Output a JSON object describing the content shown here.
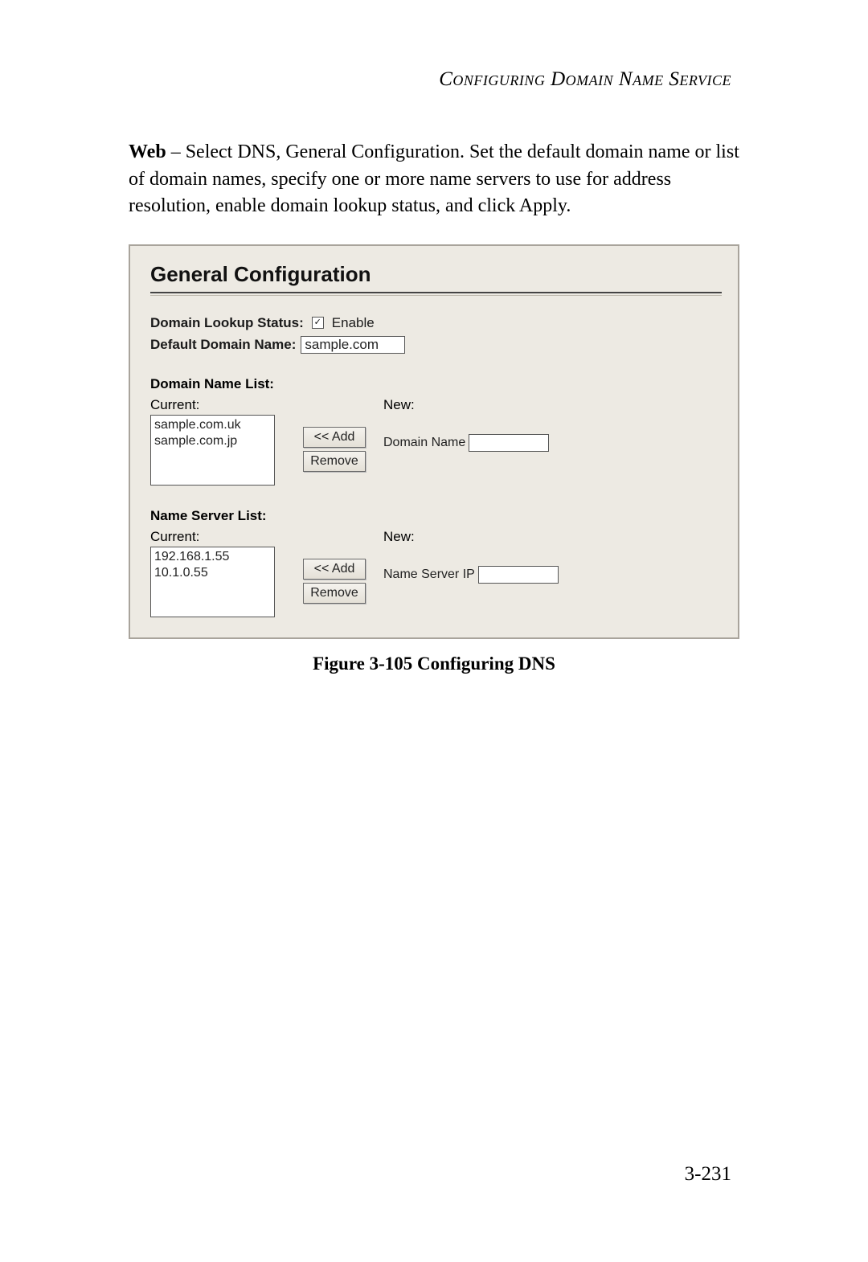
{
  "header": {
    "running_head": "Configuring Domain Name Service"
  },
  "body": {
    "lead": "Web",
    "text": " – Select DNS, General Configuration. Set the default domain name or list of domain names, specify one or more name servers to use for address resolution, enable domain lookup status, and click Apply."
  },
  "panel": {
    "title": "General Configuration",
    "lookup": {
      "label": "Domain Lookup Status:",
      "checkbox_checked": true,
      "checkbox_label": "Enable"
    },
    "default_domain": {
      "label": "Default Domain Name:",
      "value": "sample.com"
    },
    "domain_list": {
      "title": "Domain Name List:",
      "current_label": "Current:",
      "new_label": "New:",
      "items": [
        "sample.com.uk",
        "sample.com.jp"
      ],
      "add_button": "<< Add",
      "remove_button": "Remove",
      "input_label": "Domain Name",
      "input_value": ""
    },
    "ns_list": {
      "title": "Name Server List:",
      "current_label": "Current:",
      "new_label": "New:",
      "items": [
        "192.168.1.55",
        "10.1.0.55"
      ],
      "add_button": "<< Add",
      "remove_button": "Remove",
      "input_label": "Name Server IP",
      "input_value": ""
    }
  },
  "caption": "Figure 3-105  Configuring DNS",
  "page_number": "3-231"
}
